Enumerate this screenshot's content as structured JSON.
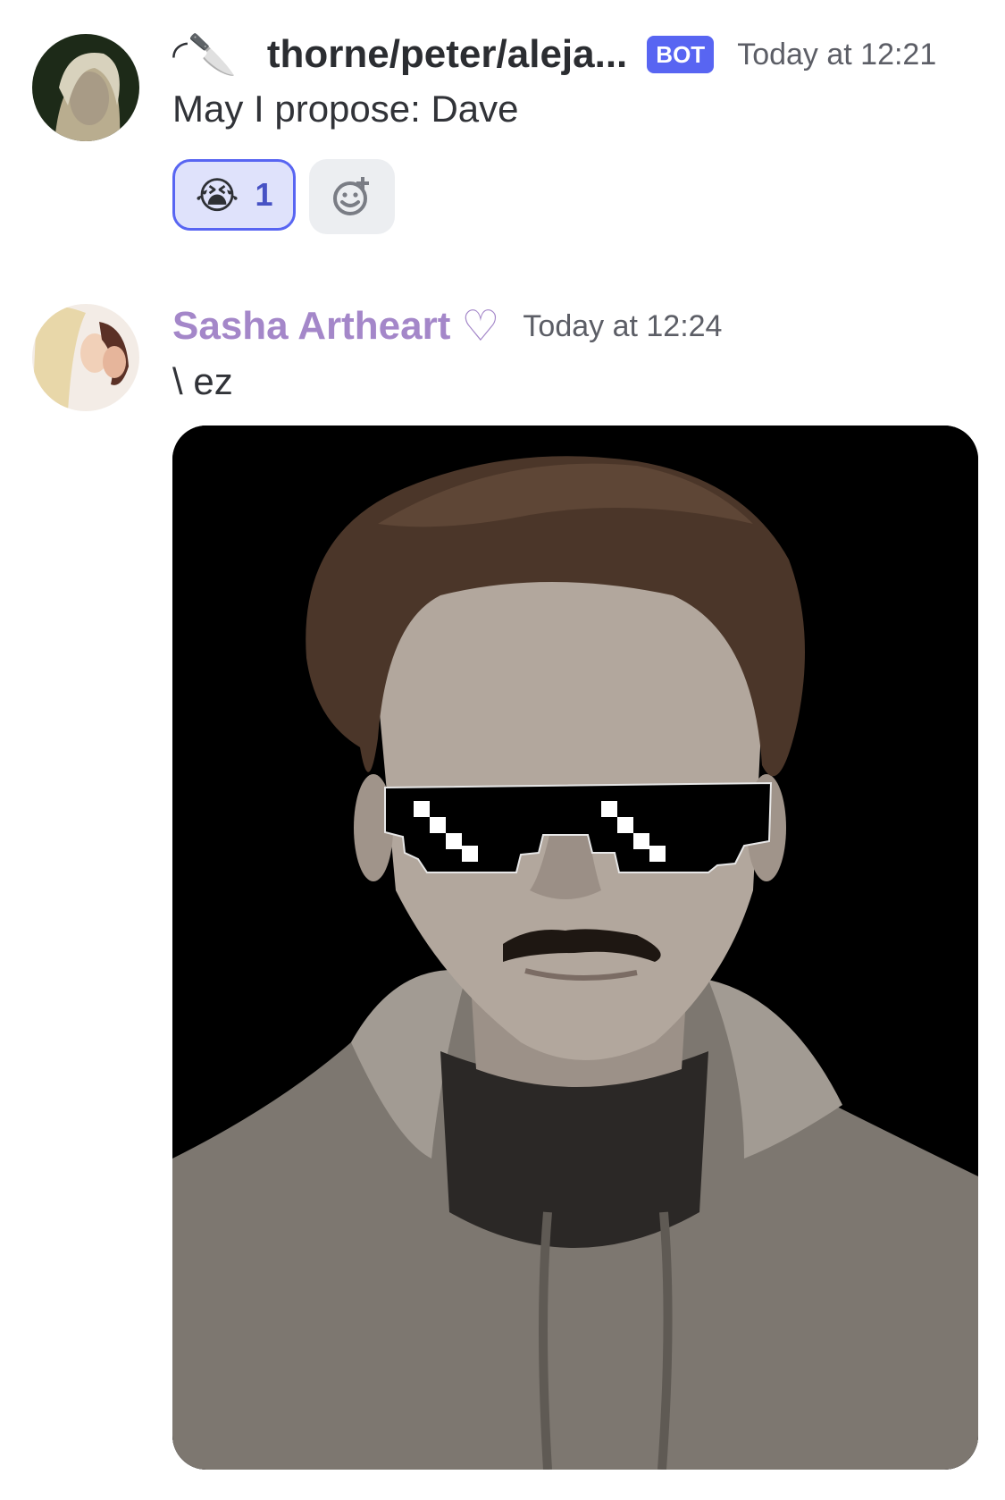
{
  "messages": [
    {
      "author_prefix": "◜🔪",
      "author": "thorne/peter/aleja...",
      "badge": "BOT",
      "timestamp": "Today at 12:21",
      "text": "May I propose: Dave",
      "reactions": [
        {
          "emoji": "😭",
          "count": "1",
          "selected": true
        }
      ],
      "add_reaction_icon": "add-reaction-icon"
    },
    {
      "author": "Sasha Artheart",
      "author_suffix": "♡",
      "timestamp": "Today at 12:24",
      "text": "\\ ez",
      "attachment": {
        "type": "image",
        "description_icon": "portrait-image"
      }
    }
  ],
  "colors": {
    "bot_badge": "#5865f2",
    "reaction_bg": "#dfe2fb",
    "reaction_border": "#5865f2",
    "sasha_name": "#a487c9"
  }
}
